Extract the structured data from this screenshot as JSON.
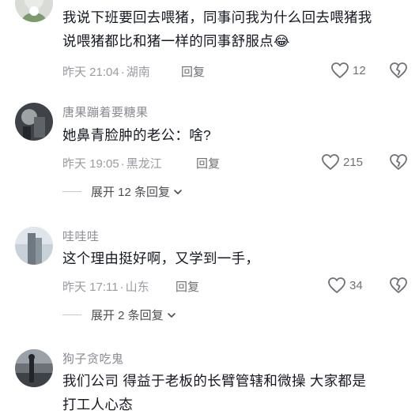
{
  "comments": [
    {
      "username": "",
      "text_line1": "我说下班要回去喂猪，同事问我为什么回去喂猪我",
      "text_line2": "说喂猪都比和猪一样的同事舒服点",
      "emoji": "😂",
      "time": "昨天 21:04",
      "location": "湖南",
      "reply_label": "回复",
      "likes": "12"
    },
    {
      "username": "唐果蹦着要糖果",
      "text_line1": "她鼻青脸肿的老公：啥?",
      "time": "昨天 19:05",
      "location": "黑龙江",
      "reply_label": "回复",
      "likes": "215",
      "expand_label": "展开 12 条回复"
    },
    {
      "username": "哇哇哇",
      "text_line1": "这个理由挺好啊，又学到一手，",
      "time": "昨天 17:11",
      "location": "山东",
      "reply_label": "回复",
      "likes": "34",
      "expand_label": "展开 2 条回复"
    },
    {
      "username": "狗子贪吃鬼",
      "text_line1": "我们公司 得益于老板的长臂管辖和微操 大家都是",
      "text_line2": "打工人心态"
    }
  ],
  "colors": {
    "text": "#161823",
    "muted": "#8a8b91",
    "icon": "#6f7075"
  }
}
